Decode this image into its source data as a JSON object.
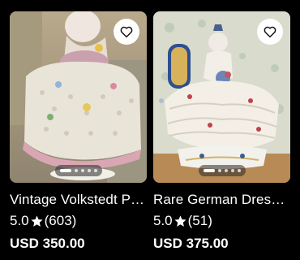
{
  "listings": [
    {
      "title": "Vintage Volkstedt Porcelain Lace Figurine",
      "rating": "5.0",
      "reviews": "(603)",
      "price": "USD 350.00"
    },
    {
      "title": "Rare German Dresden Lace Lady Figurine",
      "rating": "5.0",
      "reviews": "(51)",
      "price": "USD 375.00"
    }
  ],
  "icons": {
    "favorite": "heart-outline-icon",
    "rating": "star-icon"
  },
  "colors": {
    "background": "#000000",
    "text": "#ffffff",
    "fav_bg": "#ffffff"
  }
}
